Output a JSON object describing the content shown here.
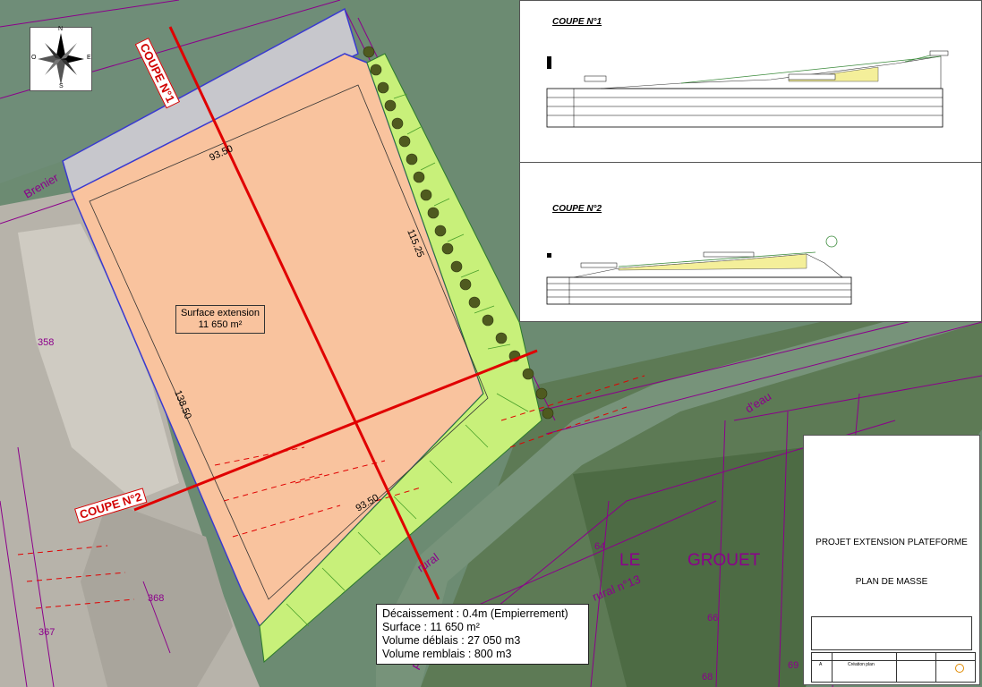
{
  "map": {
    "coupe1_label": "COUPE N°1",
    "coupe2_label": "COUPE N°2",
    "surface_title": "Surface extension",
    "surface_value": "11 650 m²",
    "dim_top": "93.50",
    "dim_right": "115.25",
    "dim_left": "138.50",
    "dim_bottom": "93.50",
    "parcel_358": "358",
    "parcel_368": "368",
    "parcel_367": "367",
    "parcel_64": "64",
    "parcel_66": "66",
    "parcel_68": "68",
    "parcel_69": "69",
    "place_le": "LE",
    "place_grouet": "GROUET",
    "road_rural13": "rural n°13",
    "road_rural": "rural",
    "road_eau": "d'eau",
    "road_brenier": "Brenier",
    "road_pon": "Pon"
  },
  "compass": {
    "n": "N",
    "s": "S",
    "e": "E",
    "o": "O"
  },
  "notes": {
    "decaissement": "Décaissement : 0.4m (Empierrement)",
    "surface": "Surface : 11 650 m²",
    "deblais": "Volume déblais : 27 050 m3",
    "remblais": "Volume remblais : 800 m3"
  },
  "sections": {
    "coupe1_title": "COUPE N°1",
    "coupe2_title": "COUPE N°2"
  },
  "title_block": {
    "project": "PROJET EXTENSION PLATEFORME",
    "plan": "PLAN DE MASSE",
    "rev_letter": "A",
    "rev_desc": "Création plan"
  },
  "colors": {
    "platform": "#f9c39e",
    "slope": "#c8f07a",
    "coupe_line": "#e00000",
    "road": "#c7c7cc",
    "boundary": "#3a3ad0",
    "cadastre": "#8b008b"
  }
}
